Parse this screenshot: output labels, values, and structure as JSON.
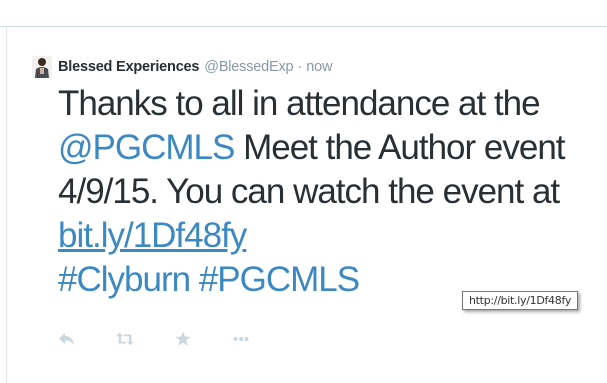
{
  "tweet": {
    "display_name": "Blessed Experiences",
    "handle": "@BlessedExp",
    "separator": "·",
    "timestamp": "now",
    "text_part1": "Thanks to all in attendance at the ",
    "mention": "@PGCMLS",
    "text_part2": " Meet the Author event 4/9/15. You can watch the event at ",
    "link": "bit.ly/1Df48fy",
    "hashtag1": "#Clyburn",
    "hashtag2": "#PGCMLS"
  },
  "actions": {
    "reply_icon": "reply-icon",
    "retweet_icon": "retweet-icon",
    "favorite_icon": "star-icon",
    "more_icon": "more-icon"
  },
  "tooltip": {
    "text": "http://bit.ly/1Df48fy"
  },
  "colors": {
    "link": "#3b88c3",
    "text": "#292f33",
    "muted": "#8899a6",
    "icon": "#ccd6dd"
  }
}
